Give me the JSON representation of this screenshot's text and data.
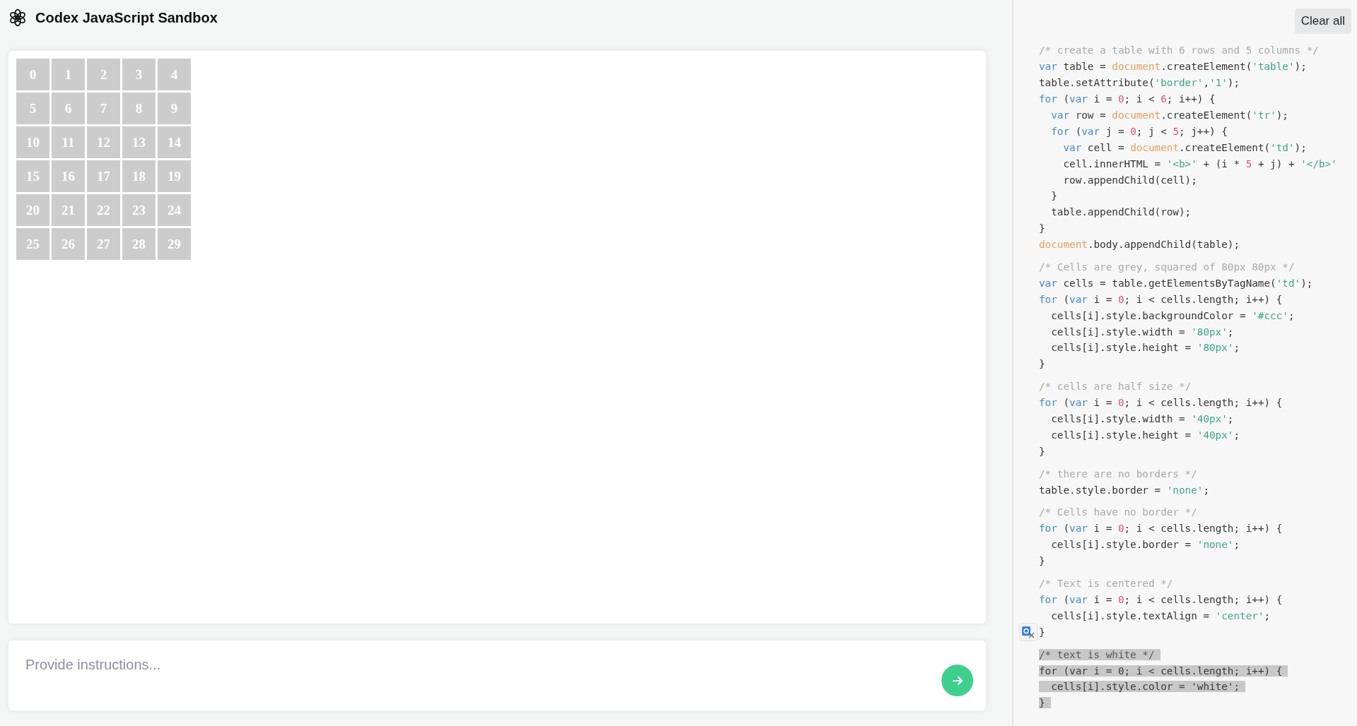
{
  "header": {
    "title": "Codex JavaScript Sandbox"
  },
  "output": {
    "table": {
      "rows": [
        [
          "0",
          "1",
          "2",
          "3",
          "4"
        ],
        [
          "5",
          "6",
          "7",
          "8",
          "9"
        ],
        [
          "10",
          "11",
          "12",
          "13",
          "14"
        ],
        [
          "15",
          "16",
          "17",
          "18",
          "19"
        ],
        [
          "20",
          "21",
          "22",
          "23",
          "24"
        ],
        [
          "25",
          "26",
          "27",
          "28",
          "29"
        ]
      ]
    }
  },
  "prompt": {
    "placeholder": "Provide instructions..."
  },
  "code_panel": {
    "clear_button": "Clear all",
    "blocks": [
      {
        "lines": [
          {
            "selected": false,
            "tokens": [
              {
                "kind": "comment",
                "text": "/* create a table with 6 rows and 5 columns */"
              }
            ]
          },
          {
            "selected": false,
            "tokens": [
              {
                "kind": "keyword",
                "text": "var"
              },
              {
                "kind": "plain",
                "text": " table = "
              },
              {
                "kind": "builtin",
                "text": "document"
              },
              {
                "kind": "plain",
                "text": ".createElement("
              },
              {
                "kind": "string",
                "text": "'table'"
              },
              {
                "kind": "plain",
                "text": ");"
              }
            ]
          },
          {
            "selected": false,
            "tokens": [
              {
                "kind": "plain",
                "text": "table.setAttribute("
              },
              {
                "kind": "string",
                "text": "'border'"
              },
              {
                "kind": "plain",
                "text": ","
              },
              {
                "kind": "string",
                "text": "'1'"
              },
              {
                "kind": "plain",
                "text": ");"
              }
            ]
          },
          {
            "selected": false,
            "tokens": [
              {
                "kind": "keyword",
                "text": "for"
              },
              {
                "kind": "plain",
                "text": " ("
              },
              {
                "kind": "keyword",
                "text": "var"
              },
              {
                "kind": "plain",
                "text": " i = "
              },
              {
                "kind": "number",
                "text": "0"
              },
              {
                "kind": "plain",
                "text": "; i < "
              },
              {
                "kind": "number",
                "text": "6"
              },
              {
                "kind": "plain",
                "text": "; i++) {"
              }
            ]
          },
          {
            "selected": false,
            "tokens": [
              {
                "kind": "keyword",
                "text": "  var"
              },
              {
                "kind": "plain",
                "text": " row = "
              },
              {
                "kind": "builtin",
                "text": "document"
              },
              {
                "kind": "plain",
                "text": ".createElement("
              },
              {
                "kind": "string",
                "text": "'tr'"
              },
              {
                "kind": "plain",
                "text": ");"
              }
            ]
          },
          {
            "selected": false,
            "tokens": [
              {
                "kind": "keyword",
                "text": "  for"
              },
              {
                "kind": "plain",
                "text": " ("
              },
              {
                "kind": "keyword",
                "text": "var"
              },
              {
                "kind": "plain",
                "text": " j = "
              },
              {
                "kind": "number",
                "text": "0"
              },
              {
                "kind": "plain",
                "text": "; j < "
              },
              {
                "kind": "number",
                "text": "5"
              },
              {
                "kind": "plain",
                "text": "; j++) {"
              }
            ]
          },
          {
            "selected": false,
            "tokens": [
              {
                "kind": "keyword",
                "text": "    var"
              },
              {
                "kind": "plain",
                "text": " cell = "
              },
              {
                "kind": "builtin",
                "text": "document"
              },
              {
                "kind": "plain",
                "text": ".createElement("
              },
              {
                "kind": "string",
                "text": "'td'"
              },
              {
                "kind": "plain",
                "text": ");"
              }
            ]
          },
          {
            "selected": false,
            "tokens": [
              {
                "kind": "plain",
                "text": "    cell.innerHTML = "
              },
              {
                "kind": "string",
                "text": "'<b>'"
              },
              {
                "kind": "plain",
                "text": " + (i * "
              },
              {
                "kind": "number",
                "text": "5"
              },
              {
                "kind": "plain",
                "text": " + j) + "
              },
              {
                "kind": "string",
                "text": "'</b>'"
              }
            ]
          },
          {
            "selected": false,
            "tokens": [
              {
                "kind": "plain",
                "text": "    row.appendChild(cell);"
              }
            ]
          },
          {
            "selected": false,
            "tokens": [
              {
                "kind": "plain",
                "text": "  }"
              }
            ]
          },
          {
            "selected": false,
            "tokens": [
              {
                "kind": "plain",
                "text": "  table.appendChild(row);"
              }
            ]
          },
          {
            "selected": false,
            "tokens": [
              {
                "kind": "plain",
                "text": "}"
              }
            ]
          },
          {
            "selected": false,
            "tokens": [
              {
                "kind": "builtin",
                "text": "document"
              },
              {
                "kind": "plain",
                "text": ".body.appendChild(table);"
              }
            ]
          }
        ]
      },
      {
        "lines": [
          {
            "selected": false,
            "tokens": [
              {
                "kind": "comment",
                "text": "/* Cells are grey, squared of 80px 80px */"
              }
            ]
          },
          {
            "selected": false,
            "tokens": [
              {
                "kind": "keyword",
                "text": "var"
              },
              {
                "kind": "plain",
                "text": " cells = table.getElementsByTagName("
              },
              {
                "kind": "string",
                "text": "'td'"
              },
              {
                "kind": "plain",
                "text": ");"
              }
            ]
          },
          {
            "selected": false,
            "tokens": [
              {
                "kind": "keyword",
                "text": "for"
              },
              {
                "kind": "plain",
                "text": " ("
              },
              {
                "kind": "keyword",
                "text": "var"
              },
              {
                "kind": "plain",
                "text": " i = "
              },
              {
                "kind": "number",
                "text": "0"
              },
              {
                "kind": "plain",
                "text": "; i < cells.length; i++) {"
              }
            ]
          },
          {
            "selected": false,
            "tokens": [
              {
                "kind": "plain",
                "text": "  cells[i].style.backgroundColor = "
              },
              {
                "kind": "string",
                "text": "'#ccc'"
              },
              {
                "kind": "plain",
                "text": ";"
              }
            ]
          },
          {
            "selected": false,
            "tokens": [
              {
                "kind": "plain",
                "text": "  cells[i].style.width = "
              },
              {
                "kind": "string",
                "text": "'80px'"
              },
              {
                "kind": "plain",
                "text": ";"
              }
            ]
          },
          {
            "selected": false,
            "tokens": [
              {
                "kind": "plain",
                "text": "  cells[i].style.height = "
              },
              {
                "kind": "string",
                "text": "'80px'"
              },
              {
                "kind": "plain",
                "text": ";"
              }
            ]
          },
          {
            "selected": false,
            "tokens": [
              {
                "kind": "plain",
                "text": "}"
              }
            ]
          }
        ]
      },
      {
        "lines": [
          {
            "selected": false,
            "tokens": [
              {
                "kind": "comment",
                "text": "/* cells are half size */"
              }
            ]
          },
          {
            "selected": false,
            "tokens": [
              {
                "kind": "keyword",
                "text": "for"
              },
              {
                "kind": "plain",
                "text": " ("
              },
              {
                "kind": "keyword",
                "text": "var"
              },
              {
                "kind": "plain",
                "text": " i = "
              },
              {
                "kind": "number",
                "text": "0"
              },
              {
                "kind": "plain",
                "text": "; i < cells.length; i++) {"
              }
            ]
          },
          {
            "selected": false,
            "tokens": [
              {
                "kind": "plain",
                "text": "  cells[i].style.width = "
              },
              {
                "kind": "string",
                "text": "'40px'"
              },
              {
                "kind": "plain",
                "text": ";"
              }
            ]
          },
          {
            "selected": false,
            "tokens": [
              {
                "kind": "plain",
                "text": "  cells[i].style.height = "
              },
              {
                "kind": "string",
                "text": "'40px'"
              },
              {
                "kind": "plain",
                "text": ";"
              }
            ]
          },
          {
            "selected": false,
            "tokens": [
              {
                "kind": "plain",
                "text": "}"
              }
            ]
          }
        ]
      },
      {
        "lines": [
          {
            "selected": false,
            "tokens": [
              {
                "kind": "comment",
                "text": "/* there are no borders */"
              }
            ]
          },
          {
            "selected": false,
            "tokens": [
              {
                "kind": "plain",
                "text": "table.style.border = "
              },
              {
                "kind": "string",
                "text": "'none'"
              },
              {
                "kind": "plain",
                "text": ";"
              }
            ]
          }
        ]
      },
      {
        "lines": [
          {
            "selected": false,
            "tokens": [
              {
                "kind": "comment",
                "text": "/* Cells have no border */"
              }
            ]
          },
          {
            "selected": false,
            "tokens": [
              {
                "kind": "keyword",
                "text": "for"
              },
              {
                "kind": "plain",
                "text": " ("
              },
              {
                "kind": "keyword",
                "text": "var"
              },
              {
                "kind": "plain",
                "text": " i = "
              },
              {
                "kind": "number",
                "text": "0"
              },
              {
                "kind": "plain",
                "text": "; i < cells.length; i++) {"
              }
            ]
          },
          {
            "selected": false,
            "tokens": [
              {
                "kind": "plain",
                "text": "  cells[i].style.border = "
              },
              {
                "kind": "string",
                "text": "'none'"
              },
              {
                "kind": "plain",
                "text": ";"
              }
            ]
          },
          {
            "selected": false,
            "tokens": [
              {
                "kind": "plain",
                "text": "}"
              }
            ]
          }
        ]
      },
      {
        "lines": [
          {
            "selected": false,
            "tokens": [
              {
                "kind": "comment",
                "text": "/* Text is centered */"
              }
            ]
          },
          {
            "selected": false,
            "tokens": [
              {
                "kind": "keyword",
                "text": "for"
              },
              {
                "kind": "plain",
                "text": " ("
              },
              {
                "kind": "keyword",
                "text": "var"
              },
              {
                "kind": "plain",
                "text": " i = "
              },
              {
                "kind": "number",
                "text": "0"
              },
              {
                "kind": "plain",
                "text": "; i < cells.length; i++) {"
              }
            ]
          },
          {
            "selected": false,
            "tokens": [
              {
                "kind": "plain",
                "text": "  cells[i].style.textAlign = "
              },
              {
                "kind": "string",
                "text": "'center'"
              },
              {
                "kind": "plain",
                "text": ";"
              }
            ]
          },
          {
            "selected": false,
            "tokens": [
              {
                "kind": "plain",
                "text": "}"
              }
            ]
          }
        ]
      },
      {
        "lines": [
          {
            "selected": true,
            "tokens": [
              {
                "kind": "comment",
                "text": "/* text is white */"
              }
            ]
          },
          {
            "selected": true,
            "tokens": [
              {
                "kind": "keyword",
                "text": "for"
              },
              {
                "kind": "plain",
                "text": " ("
              },
              {
                "kind": "keyword",
                "text": "var"
              },
              {
                "kind": "plain",
                "text": " i = "
              },
              {
                "kind": "number",
                "text": "0"
              },
              {
                "kind": "plain",
                "text": "; i < cells.length; i++) {"
              }
            ]
          },
          {
            "selected": true,
            "tokens": [
              {
                "kind": "plain",
                "text": "  cells[i].style.color = "
              },
              {
                "kind": "string",
                "text": "'white'"
              },
              {
                "kind": "plain",
                "text": ";"
              }
            ]
          },
          {
            "selected": true,
            "tokens": [
              {
                "kind": "plain",
                "text": "}"
              }
            ]
          }
        ]
      }
    ]
  }
}
